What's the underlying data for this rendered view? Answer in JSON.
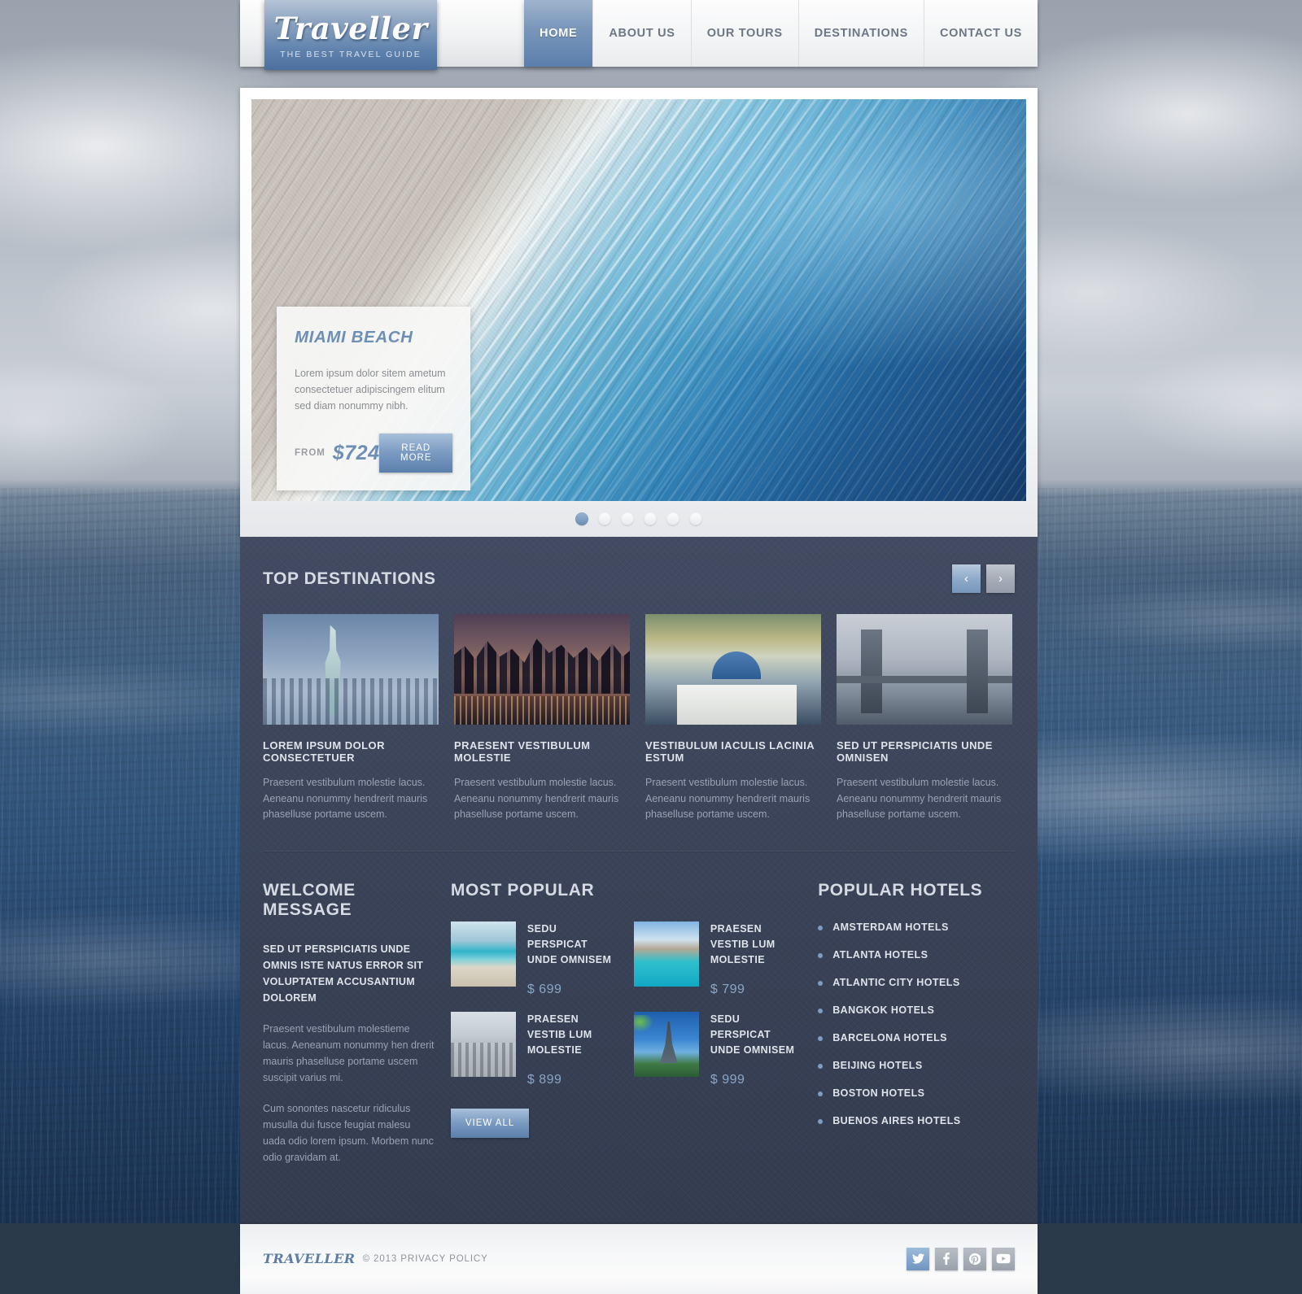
{
  "header": {
    "logo_word": "Traveller",
    "logo_tagline": "THE BEST TRAVEL GUIDE",
    "nav": [
      {
        "label": "HOME",
        "active": true
      },
      {
        "label": "ABOUT US",
        "active": false
      },
      {
        "label": "OUR TOURS",
        "active": false
      },
      {
        "label": "DESTINATIONS",
        "active": false
      },
      {
        "label": "CONTACT US",
        "active": false
      }
    ]
  },
  "slider": {
    "caption_title": "MIAMI BEACH",
    "caption_text": "Lorem ipsum dolor sitem ametum consectetuer adipiscingem elitum sed diam nonummy nibh.",
    "from_label": "FROM",
    "price": "$724",
    "read_more_label": "READ MORE",
    "dots": [
      "1",
      "2",
      "3",
      "4",
      "5",
      "6"
    ],
    "active_dot": 1
  },
  "top_destinations": {
    "title": "TOP DESTINATIONS",
    "prev_icon": "chevron-left-icon",
    "next_icon": "chevron-right-icon",
    "items": [
      {
        "title": "LOREM IPSUM DOLOR CONSECTETUER",
        "text": "Praesent vestibulum molestie lacus. Aeneanu nonummy hendrerit mauris phaselluse portame uscem.",
        "image": "statue-of-liberty-photo"
      },
      {
        "title": "PRAESENT VESTIBULUM MOLESTIE",
        "text": "Praesent vestibulum molestie lacus. Aeneanu nonummy hendrerit mauris phaselluse portame uscem.",
        "image": "city-skyline-night-photo"
      },
      {
        "title": "VESTIBULUM IACULIS LACINIA ESTUM",
        "text": "Praesent vestibulum molestie lacus. Aeneanu nonummy hendrerit mauris phaselluse portame uscem.",
        "image": "santorini-blue-dome-photo"
      },
      {
        "title": "SED UT PERSPICIATIS UNDE OMNISEN",
        "text": "Praesent vestibulum molestie lacus. Aeneanu nonummy hendrerit mauris phaselluse portame uscem.",
        "image": "tower-bridge-photo"
      }
    ]
  },
  "welcome": {
    "title": "WELCOME MESSAGE",
    "subtitle": "SED UT PERSPICIATIS UNDE OMNIS ISTE NATUS ERROR SIT VOLUPTATEM ACCUSANTIUM DOLOREM",
    "paragraph1": "Praesent vestibulum molestieme lacus. Aeneanum nonummy hen drerit mauris phaselluse portame uscem suscipit varius mi.",
    "paragraph2": "Cum sonontes nascetur ridiculus musulla dui fusce feugiat malesu uada odio lorem ipsum. Morbem nunc odio gravidam at."
  },
  "most_popular": {
    "title": "MOST POPULAR",
    "view_all_label": "VIEW ALL",
    "items": [
      {
        "title": "SEDU PERSPICAT UNDE OMNISEM",
        "price": "$ 699",
        "image": "beach-photo"
      },
      {
        "title": "PRAESEN VESTIB LUM MOLESTIE",
        "price": "$ 799",
        "image": "lagoon-photo"
      },
      {
        "title": "PRAESEN VESTIB LUM MOLESTIE",
        "price": "$ 899",
        "image": "nyc-aerial-photo"
      },
      {
        "title": "SEDU PERSPICAT UNDE OMNISEM",
        "price": "$ 999",
        "image": "eiffel-tower-photo"
      }
    ]
  },
  "popular_hotels": {
    "title": "POPULAR HOTELS",
    "items": [
      "AMSTERDAM HOTELS",
      "ATLANTA HOTELS",
      "ATLANTIC CITY HOTELS",
      "BANGKOK HOTELS",
      "BARCELONA HOTELS",
      "BEIJING HOTELS",
      "BOSTON HOTELS",
      "BUENOS AIRES HOTELS"
    ]
  },
  "footer": {
    "logo": "TRAVELLER",
    "copyright": "© 2013 PRIVACY POLICY",
    "socials": [
      {
        "name": "twitter-icon",
        "active": true
      },
      {
        "name": "facebook-icon",
        "active": false
      },
      {
        "name": "pinterest-icon",
        "active": false
      },
      {
        "name": "youtube-icon",
        "active": false
      }
    ]
  },
  "colors": {
    "accent_blue": "#6e8fb5",
    "dark_panel": "#3b445a",
    "heading_light": "#d6dae2",
    "body_muted": "#9aa3b4"
  }
}
